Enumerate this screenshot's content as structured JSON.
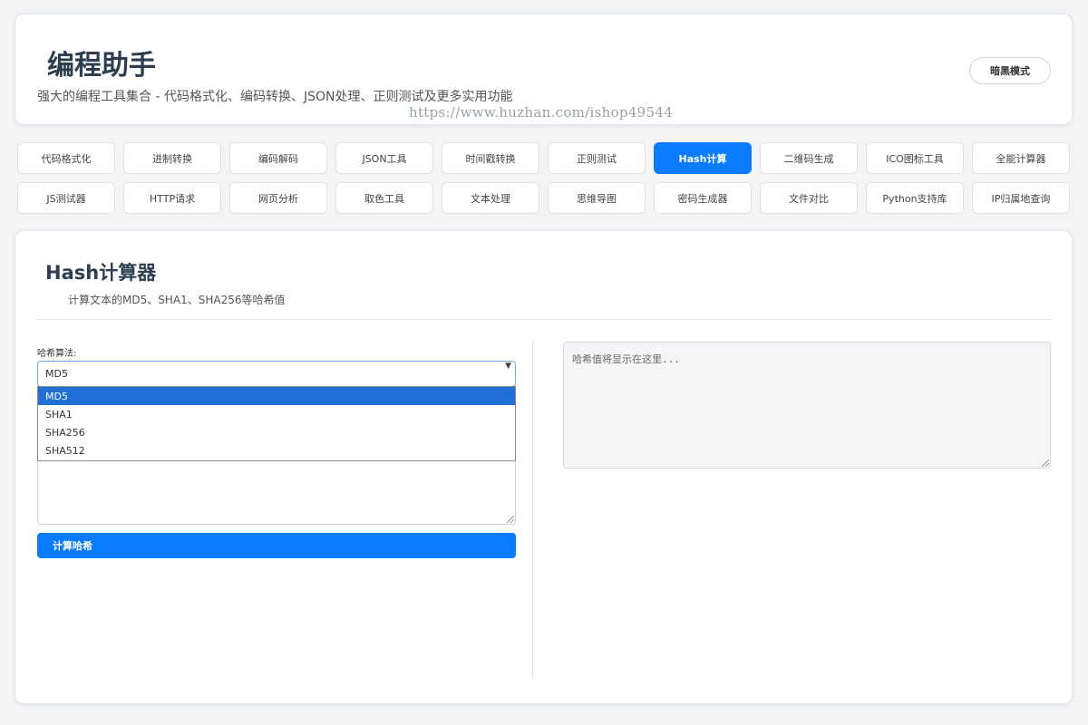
{
  "header": {
    "title": "编程助手",
    "subtitle": "强大的编程工具集合 - 代码格式化、编码转换、JSON处理、正则测试及更多实用功能",
    "watermark": "https://www.huzhan.com/ishop49544",
    "dark_mode_label": "暗黑模式"
  },
  "tabs_row1": [
    {
      "label": "代码格式化",
      "active": false
    },
    {
      "label": "进制转换",
      "active": false
    },
    {
      "label": "编码解码",
      "active": false
    },
    {
      "label": "JSON工具",
      "active": false
    },
    {
      "label": "时间戳转换",
      "active": false
    },
    {
      "label": "正则测试",
      "active": false
    },
    {
      "label": "Hash计算",
      "active": true
    },
    {
      "label": "二维码生成",
      "active": false
    },
    {
      "label": "ICO图标工具",
      "active": false
    },
    {
      "label": "全能计算器",
      "active": false
    }
  ],
  "tabs_row2": [
    {
      "label": "JS测试器",
      "active": false
    },
    {
      "label": "HTTP请求",
      "active": false
    },
    {
      "label": "网页分析",
      "active": false
    },
    {
      "label": "取色工具",
      "active": false
    },
    {
      "label": "文本处理",
      "active": false
    },
    {
      "label": "思维导图",
      "active": false
    },
    {
      "label": "密码生成器",
      "active": false
    },
    {
      "label": "文件对比",
      "active": false
    },
    {
      "label": "Python支持库",
      "active": false
    },
    {
      "label": "IP归属地查询",
      "active": false
    }
  ],
  "tool": {
    "title": "Hash计算器",
    "description": "计算文本的MD5、SHA1、SHA256等哈希值",
    "algorithm_label": "哈希算法:",
    "algorithm_selected": "MD5",
    "algorithm_options": [
      "MD5",
      "SHA1",
      "SHA256",
      "SHA512"
    ],
    "compute_label": "计算哈希",
    "output_placeholder": "哈希值将显示在这里..."
  },
  "colors": {
    "accent": "#0b7bff",
    "option_highlight": "#1f6fd6",
    "background": "#f3f4f6"
  }
}
